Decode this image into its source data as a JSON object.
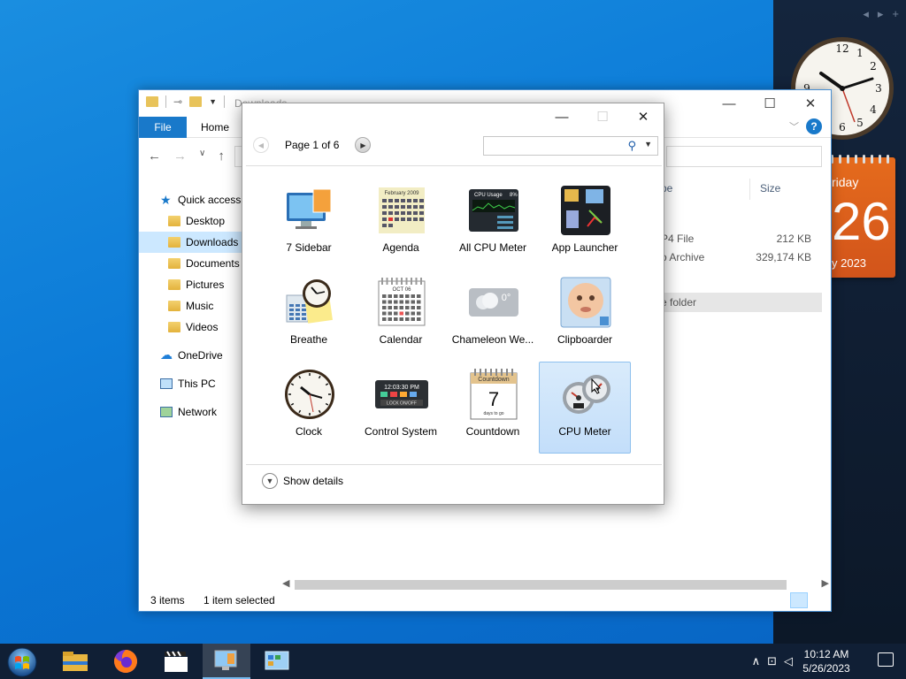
{
  "explorer": {
    "title": "Downloads",
    "tabs": {
      "file": "File",
      "home": "Home"
    },
    "nav": [
      {
        "label": "Quick access",
        "type": "star"
      },
      {
        "label": "Desktop",
        "type": "folder"
      },
      {
        "label": "Downloads",
        "type": "folder",
        "selected": true
      },
      {
        "label": "Documents",
        "type": "folder"
      },
      {
        "label": "Pictures",
        "type": "folder"
      },
      {
        "label": "Music",
        "type": "folder"
      },
      {
        "label": "Videos",
        "type": "folder"
      },
      {
        "label": "OneDrive",
        "type": "cloud"
      },
      {
        "label": "This PC",
        "type": "pc"
      },
      {
        "label": "Network",
        "type": "network"
      }
    ],
    "columns": {
      "type": "pe",
      "size": "Size"
    },
    "files": [
      {
        "type": "P4 File",
        "size": "212 KB"
      },
      {
        "type": "o Archive",
        "size": "329,174 KB"
      }
    ],
    "folder_row": "e folder",
    "status": {
      "items": "3 items",
      "selected": "1 item selected"
    }
  },
  "gallery": {
    "page_label": "Page 1 of 6",
    "search_placeholder": "",
    "gadgets": [
      {
        "name": "7 Sidebar",
        "icon": "sidebar-monitor-icon"
      },
      {
        "name": "Agenda",
        "icon": "agenda-calendar-icon"
      },
      {
        "name": "All CPU Meter",
        "icon": "cpu-usage-icon"
      },
      {
        "name": "App Launcher",
        "icon": "app-launcher-icon"
      },
      {
        "name": "Breathe",
        "icon": "breathe-clock-icon"
      },
      {
        "name": "Calendar",
        "icon": "calendar-icon"
      },
      {
        "name": "Chameleon We...",
        "icon": "weather-icon"
      },
      {
        "name": "Clipboarder",
        "icon": "clipboarder-icon"
      },
      {
        "name": "Clock",
        "icon": "clock-icon"
      },
      {
        "name": "Control System",
        "icon": "control-system-icon"
      },
      {
        "name": "Countdown",
        "icon": "countdown-icon"
      },
      {
        "name": "CPU Meter",
        "icon": "cpu-meter-icon",
        "selected": true
      }
    ],
    "show_details": "Show details"
  },
  "thumb_text": {
    "agenda_month": "February 2009",
    "cpu_title": "CPU Usage",
    "cpu_pct": "8%",
    "calendar_month": "OCT 06",
    "weather_temp": "0°",
    "control_time": "12:03:30 PM",
    "control_lock": "LOCK ON/OFF",
    "countdown_title": "Countdown",
    "countdown_num": "7",
    "countdown_sub": "days to go"
  },
  "calendar_gadget": {
    "weekday": "riday",
    "day": "26",
    "month": "y 2023"
  },
  "taskbar": {
    "time": "10:12 AM",
    "date": "5/26/2023",
    "apps": [
      "file-explorer-icon",
      "firefox-icon",
      "video-editor-icon",
      "gadgets-icon",
      "control-panel-icon"
    ]
  },
  "colors": {
    "accent": "#1979ca",
    "selection": "#cce8ff",
    "taskbar": "#101f35",
    "calendar": "#e0601b"
  }
}
